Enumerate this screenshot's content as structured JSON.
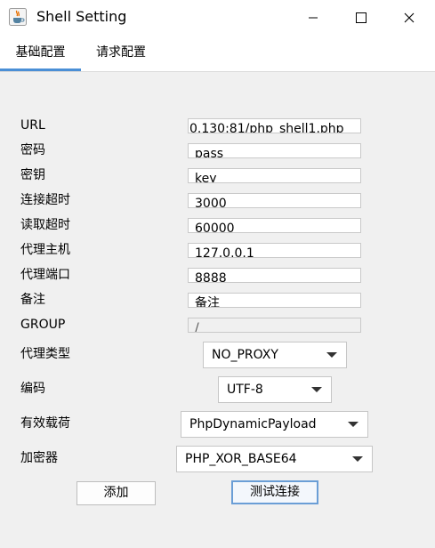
{
  "window": {
    "title": "Shell Setting",
    "icon": "java-cup-icon",
    "minimize_glyph": "—",
    "maximize_glyph": "☐",
    "close_glyph": "✕"
  },
  "tabs": [
    {
      "label": "基础配置",
      "active": true
    },
    {
      "label": "请求配置",
      "active": false
    }
  ],
  "form": {
    "url": {
      "label": "URL",
      "value": "0.130:81/php_shell1.php"
    },
    "password": {
      "label": "密码",
      "value": "pass"
    },
    "key": {
      "label": "密钥",
      "value": "key"
    },
    "connect_timeout": {
      "label": "连接超时",
      "value": "3000"
    },
    "read_timeout": {
      "label": "读取超时",
      "value": "60000"
    },
    "proxy_host": {
      "label": "代理主机",
      "value": "127.0.0.1"
    },
    "proxy_port": {
      "label": "代理端口",
      "value": "8888"
    },
    "remark": {
      "label": "备注",
      "value": "备注"
    },
    "group": {
      "label": "GROUP",
      "value": "/"
    },
    "proxy_type": {
      "label": "代理类型",
      "value": "NO_PROXY"
    },
    "encoding": {
      "label": "编码",
      "value": "UTF-8"
    },
    "payload": {
      "label": "有效载荷",
      "value": "PhpDynamicPayload"
    },
    "cryption": {
      "label": "加密器",
      "value": "PHP_XOR_BASE64"
    }
  },
  "buttons": {
    "add": "添加",
    "test": "测试连接"
  },
  "colors": {
    "tab_underline": "#4a8fd6",
    "default_button_border": "#6a9ed6",
    "panel_bg": "#f0f0f0"
  }
}
